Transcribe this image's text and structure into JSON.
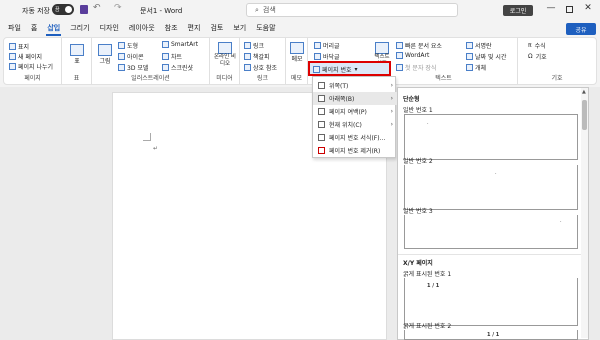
{
  "titlebar": {
    "autosave_label": "자동 저장",
    "autosave_state": "끔",
    "doc_title": "문서1 - Word",
    "search_placeholder": "검색",
    "login_label": "로그인",
    "minimize": "—",
    "maximize": "□",
    "close": "✕"
  },
  "tabs": [
    "파일",
    "홈",
    "삽입",
    "그리기",
    "디자인",
    "레이아웃",
    "참조",
    "편지",
    "검토",
    "보기",
    "도움말"
  ],
  "active_tab": "삽입",
  "share_label": "공유",
  "ribbon": {
    "pages_group": {
      "label": "페이지",
      "items": [
        "표지",
        "새 페이지",
        "페이지 나누기"
      ]
    },
    "table_group": {
      "label": "표",
      "items": [
        "표"
      ]
    },
    "illust_group": {
      "label": "일러스트레이션",
      "items": [
        "그림",
        "도형",
        "아이콘",
        "3D 모델",
        "SmartArt",
        "차트",
        "스크린샷"
      ]
    },
    "media_group": {
      "label": "미디어",
      "items": [
        "온라인 비디오"
      ]
    },
    "links_group": {
      "label": "링크",
      "items": [
        "링크",
        "책갈피",
        "상호 참조"
      ]
    },
    "comment_group": {
      "label": "메모",
      "items": [
        "메모"
      ]
    },
    "header_group": {
      "items": [
        "머리글",
        "바닥글",
        "페이지 번호"
      ]
    },
    "text_group": {
      "label": "텍스트",
      "items": [
        "텍스트 상자",
        "빠른 문서 요소",
        "WordArt",
        "첫 문자 장식",
        "서명란",
        "날짜 및 시간",
        "개체"
      ]
    },
    "symbol_group": {
      "label": "기호",
      "items": [
        "수식",
        "기호"
      ]
    }
  },
  "page_number_menu": {
    "items": [
      {
        "label": "위쪽(T)",
        "arrow": true
      },
      {
        "label": "아래쪽(B)",
        "arrow": true
      },
      {
        "label": "페이지 여백(P)",
        "arrow": true
      },
      {
        "label": "현재 위치(C)",
        "arrow": true
      },
      {
        "label": "페이지 번호 서식(F)...",
        "arrow": false
      },
      {
        "label": "페이지 번호 제거(R)",
        "arrow": false
      }
    ]
  },
  "gallery": {
    "section1": "단순형",
    "items1": [
      "일반 번호 1",
      "일반 번호 2",
      "일반 번호 3"
    ],
    "section2": "X/Y 페이지",
    "items2": [
      "굵게 표시된 번호 1",
      "굵게 표시된 번호 2"
    ],
    "bold_sample": "1 / 1"
  }
}
